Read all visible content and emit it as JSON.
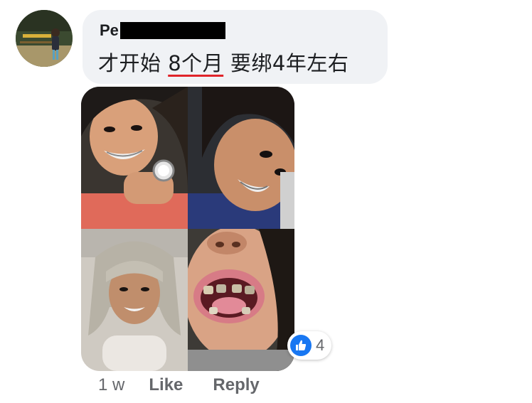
{
  "comment": {
    "author_visible": "Pe",
    "text_before": "才开始 ",
    "text_underlined": "8个月",
    "text_after": " 要绑4年左右",
    "underline_color": "#e0242a"
  },
  "photos": [
    {
      "name": "selfie-top-left"
    },
    {
      "name": "selfie-top-right"
    },
    {
      "name": "selfie-bottom-left"
    },
    {
      "name": "open-mouth-bottom-right"
    }
  ],
  "reaction": {
    "icon": "thumbs-up-icon",
    "count": "4",
    "color": "#1877f2"
  },
  "actions": {
    "time": "1 w",
    "like_label": "Like",
    "reply_label": "Reply"
  }
}
